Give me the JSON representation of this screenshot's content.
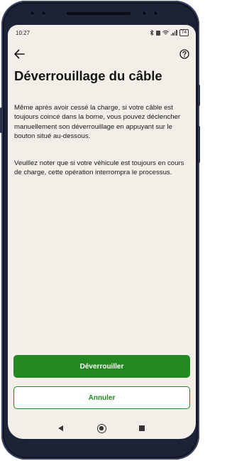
{
  "status_bar": {
    "time": "10:27",
    "battery": "74"
  },
  "header": {
    "back_icon": "arrow-left-icon",
    "help_icon": "help-circle-icon"
  },
  "page": {
    "title": "Déverrouillage du câble",
    "paragraph_1": "Même après avoir cessé la charge, si votre câble est toujours coincé dans la borne, vous pouvez déclencher manuellement son déverrouillage en appuyant sur le bouton situé au-dessous.",
    "paragraph_2": "Veuillez noter que si votre véhicule est toujours en cours de charge, cette opération interrompra le processus."
  },
  "actions": {
    "unlock_label": "Déverrouiller",
    "cancel_label": "Annuler"
  },
  "colors": {
    "accent": "#22881f",
    "background": "#f1efe8",
    "text": "#161616"
  },
  "nav_bar": {
    "back_icon": "nav-back-icon",
    "home_icon": "nav-home-icon",
    "recents_icon": "nav-recents-icon"
  }
}
